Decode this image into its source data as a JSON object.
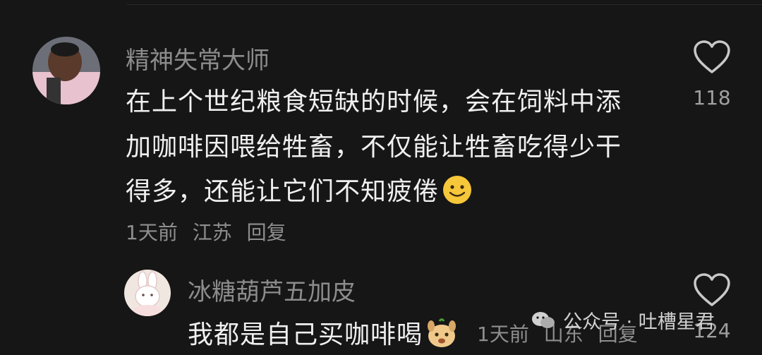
{
  "comments": [
    {
      "username": "精神失常大师",
      "lines": [
        "在上个世纪粮食短缺的时候，会在饲料中添",
        "加咖啡因喂给牲畜，不仅能让牲畜吃得少干",
        "得多，还能让它们不知疲倦"
      ],
      "emoji": "smile-emoji",
      "meta": {
        "time": "1天前",
        "location": "江苏",
        "reply": "回复"
      },
      "likes": "118"
    },
    {
      "username": "冰糖葫芦五加皮",
      "lines": [
        "我都是自己买咖啡喝"
      ],
      "emoji": "dog-emoji",
      "meta": {
        "time": "1天前",
        "location": "山东",
        "reply": "回复"
      },
      "likes": "124"
    }
  ],
  "watermark": {
    "label": "公众号 · 吐槽星君"
  },
  "icons": {
    "like": "heart-outline-icon",
    "watermark": "wechat-icon"
  },
  "colors": {
    "background": "#161616",
    "username": "#8c8c8c",
    "text": "#f0f0f0",
    "meta": "#8e8e8e"
  }
}
